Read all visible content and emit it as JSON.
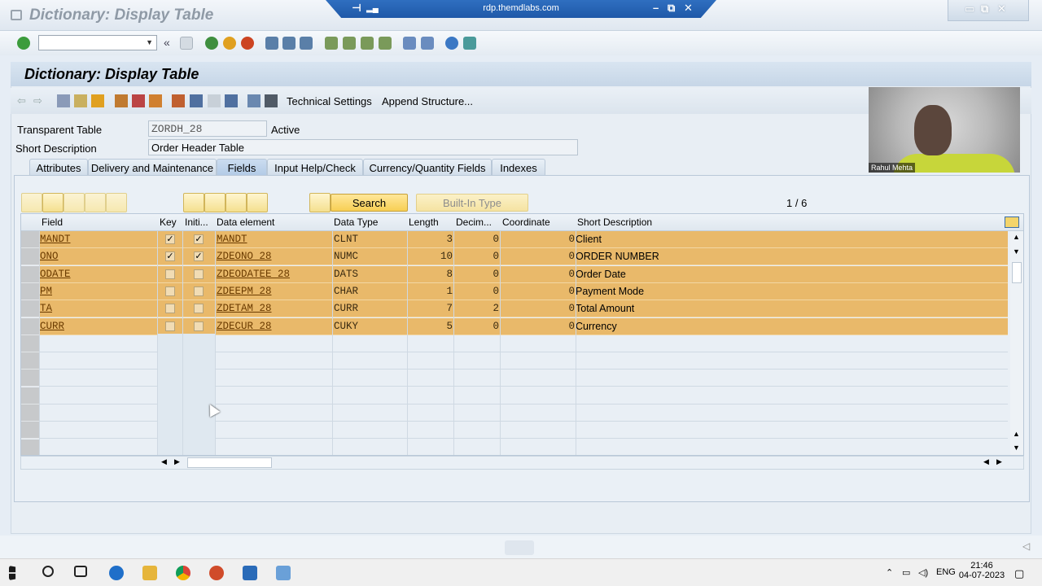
{
  "window": {
    "title": "Dictionary: Display Table",
    "rdp_host": "rdp.themdlabs.com"
  },
  "toolbar": {
    "command_field_value": ""
  },
  "screen": {
    "title": "Dictionary: Display Table",
    "app_buttons": [
      "Technical Settings",
      "Append Structure..."
    ]
  },
  "form": {
    "transparent_table_label": "Transparent Table",
    "transparent_table_value": "ZORDH_28",
    "status": "Active",
    "short_description_label": "Short Description",
    "short_description_value": "Order Header Table"
  },
  "tabs": [
    "Attributes",
    "Delivery and Maintenance",
    "Fields",
    "Input Help/Check",
    "Currency/Quantity Fields",
    "Indexes"
  ],
  "active_tab": "Fields",
  "table_toolbar": {
    "search_label": "Search",
    "builtin_type_label": "Built-In Type",
    "pager": "1  /  6"
  },
  "grid": {
    "columns": [
      "Field",
      "Key",
      "Initi...",
      "Data element",
      "Data Type",
      "Length",
      "Decim...",
      "Coordinate",
      "Short Description"
    ],
    "rows": [
      {
        "field": "MANDT",
        "key": true,
        "initial": true,
        "data_element": "MANDT",
        "data_type": "CLNT",
        "length": "3",
        "decimals": "0",
        "coordinate": "0",
        "short_description": "Client"
      },
      {
        "field": "ONO",
        "key": true,
        "initial": true,
        "data_element": "ZDEONO_28",
        "data_type": "NUMC",
        "length": "10",
        "decimals": "0",
        "coordinate": "0",
        "short_description": "ORDER NUMBER"
      },
      {
        "field": "ODATE",
        "key": false,
        "initial": false,
        "data_element": "ZDEODATEE_28",
        "data_type": "DATS",
        "length": "8",
        "decimals": "0",
        "coordinate": "0",
        "short_description": "Order Date"
      },
      {
        "field": "PM",
        "key": false,
        "initial": false,
        "data_element": "ZDEEPM_28",
        "data_type": "CHAR",
        "length": "1",
        "decimals": "0",
        "coordinate": "0",
        "short_description": "Payment Mode"
      },
      {
        "field": "TA",
        "key": false,
        "initial": false,
        "data_element": "ZDETAM_28",
        "data_type": "CURR",
        "length": "7",
        "decimals": "2",
        "coordinate": "0",
        "short_description": "Total Amount"
      },
      {
        "field": "CURR",
        "key": false,
        "initial": false,
        "data_element": "ZDECUR_28",
        "data_type": "CUKY",
        "length": "5",
        "decimals": "0",
        "coordinate": "0",
        "short_description": "Currency"
      }
    ]
  },
  "video": {
    "presenter_name": "Rahul Mehta"
  },
  "taskbar": {
    "language": "ENG",
    "time": "21:46",
    "date": "04-07-2023"
  },
  "colors": {
    "row_highlight": "#e9b96a",
    "search_button": "#f7cf54",
    "header_bg": "#c6d6e7"
  }
}
